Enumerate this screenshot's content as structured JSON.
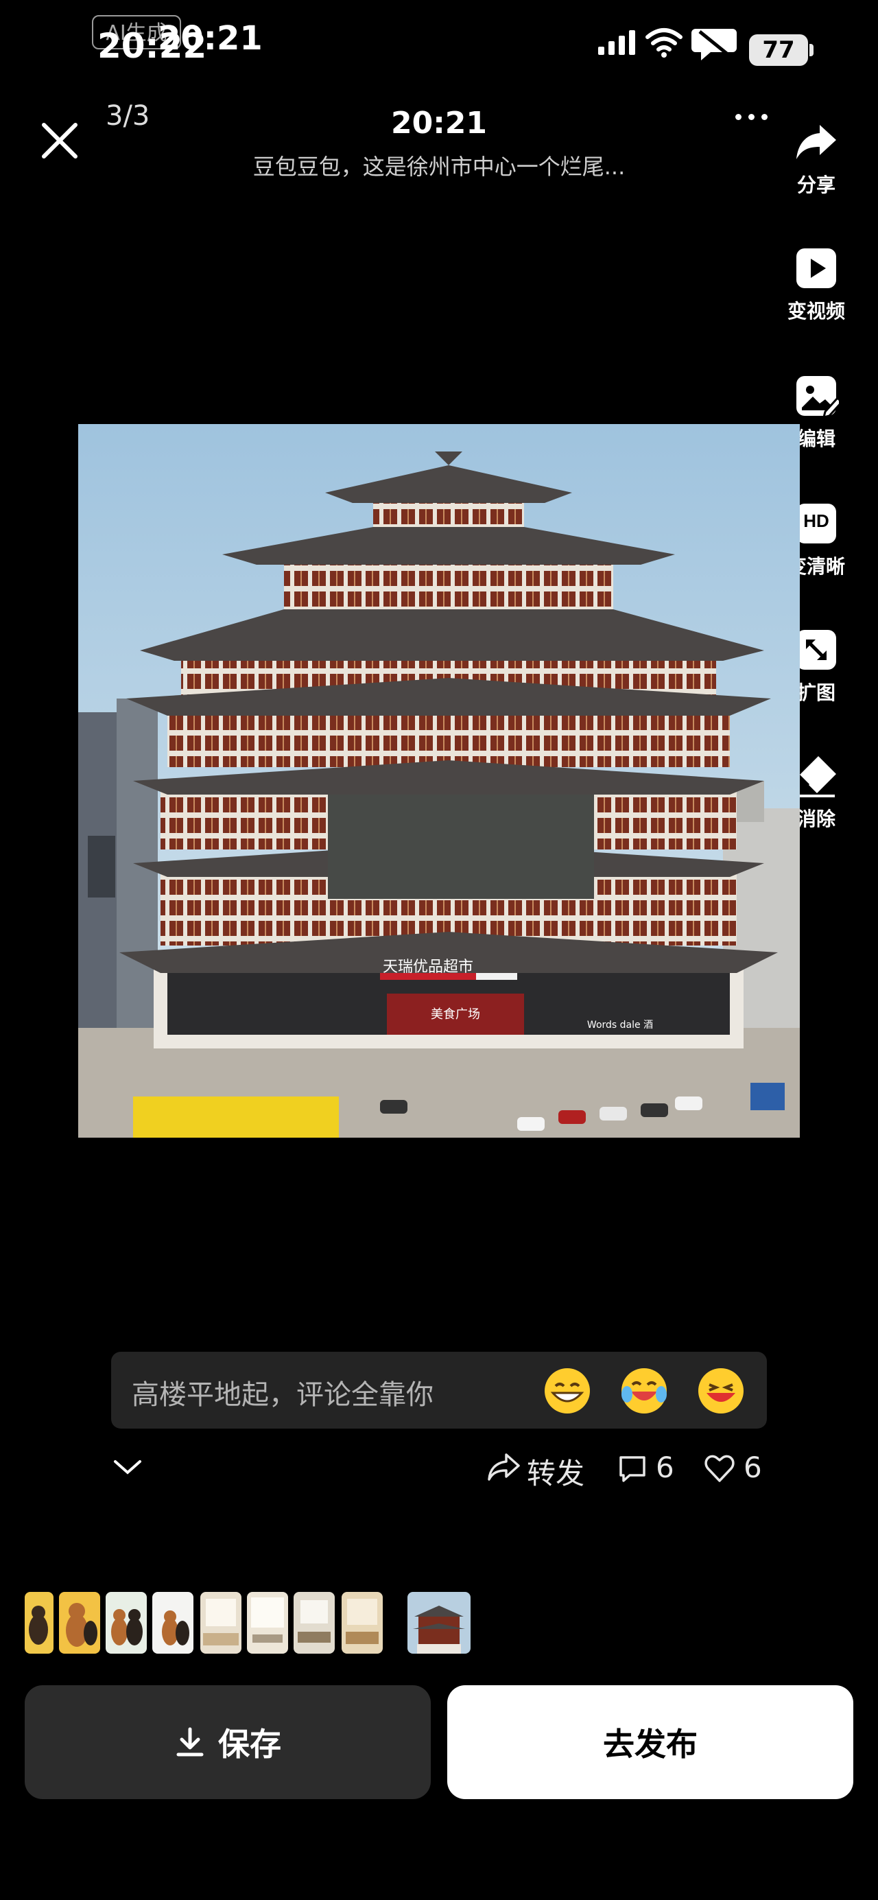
{
  "status_bar": {
    "badge": "AI生成",
    "time_main": "20:22",
    "time_overlay": "20:21",
    "battery": "77"
  },
  "header": {
    "page_counter": "3/3",
    "time": "20:21",
    "subtitle": "豆包豆包，这是徐州市中心一个烂尾..."
  },
  "tools": [
    {
      "label": "分享",
      "icon": "share-icon"
    },
    {
      "label": "变视频",
      "icon": "play-icon"
    },
    {
      "label": "编辑",
      "icon": "image-edit-icon"
    },
    {
      "label": "变清晰",
      "icon": "hd-icon",
      "icon_text": "HD"
    },
    {
      "label": "扩图",
      "icon": "expand-icon"
    },
    {
      "label": "消除",
      "icon": "eraser-icon"
    }
  ],
  "image": {
    "store_sign": "天瑞优品超市",
    "store_sign_lower": "美食广场",
    "shop_sign": "Words dale 酒"
  },
  "comment": {
    "placeholder": "高楼平地起，评论全靠你",
    "emojis": [
      "grin-emoji",
      "laugh-cry-emoji",
      "laugh-emoji"
    ]
  },
  "actions": {
    "share_label": "转发",
    "comment_count": "6",
    "like_count": "6"
  },
  "thumbnails": [
    "bear-thumb",
    "bear-thumb",
    "bear-thumb",
    "bear-thumb",
    "room-thumb",
    "room-thumb",
    "room-thumb",
    "room-thumb",
    "building-thumb"
  ],
  "buttons": {
    "save_label": "保存",
    "publish_label": "去发布"
  },
  "colors": {
    "background": "#000000",
    "comment_box": "#242424",
    "save_button": "#2c2c2c",
    "publish_button": "#ffffff"
  }
}
